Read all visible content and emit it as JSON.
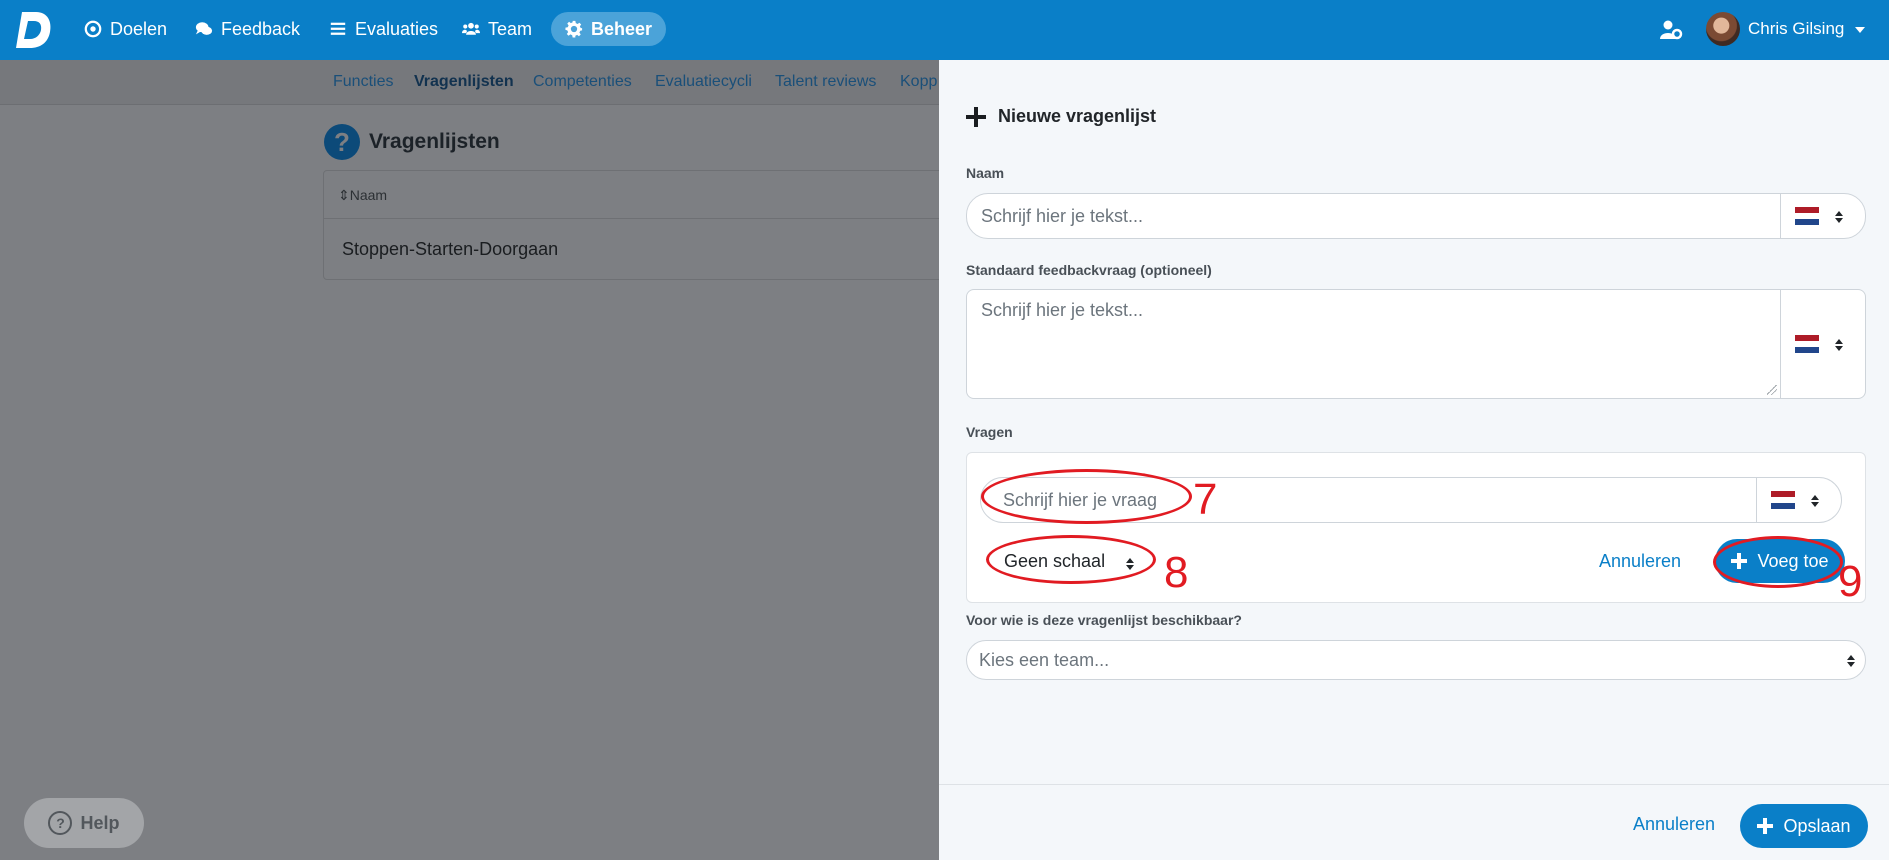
{
  "navbar": {
    "items": [
      {
        "label": "Doelen",
        "icon": "target-icon"
      },
      {
        "label": "Feedback",
        "icon": "chat-icon"
      },
      {
        "label": "Evaluaties",
        "icon": "list-icon"
      },
      {
        "label": "Team",
        "icon": "users-icon"
      },
      {
        "label": "Beheer",
        "icon": "gear-icon",
        "active": true
      }
    ],
    "user_name": "Chris Gilsing"
  },
  "subnav": {
    "items": [
      "Functies",
      "Vragenlijsten",
      "Competenties",
      "Evaluatiecycli",
      "Talent reviews",
      "Kopp"
    ],
    "active": "Vragenlijsten"
  },
  "page": {
    "title": "Vragenlijsten",
    "table": {
      "column": "Naam",
      "rows": [
        "Stoppen-Starten-Doorgaan"
      ]
    }
  },
  "help": {
    "label": "Help"
  },
  "panel": {
    "title": "Nieuwe vragenlijst",
    "name_label": "Naam",
    "name_placeholder": "Schrijf hier je tekst...",
    "feedback_label": "Standaard feedbackvraag (optioneel)",
    "feedback_placeholder": "Schrijf hier je tekst...",
    "questions_label": "Vragen",
    "question_placeholder": "Schrijf hier je vraag",
    "scale_value": "Geen schaal",
    "cancel_question": "Annuleren",
    "add_question": "Voeg toe",
    "availability_label": "Voor wie is deze vragenlijst beschikbaar?",
    "team_placeholder": "Kies een team...",
    "cancel": "Annuleren",
    "save": "Opslaan"
  },
  "annotations": [
    "7",
    "8",
    "9"
  ],
  "colors": {
    "primary": "#0a7fc8",
    "annotation": "#e11b22"
  }
}
